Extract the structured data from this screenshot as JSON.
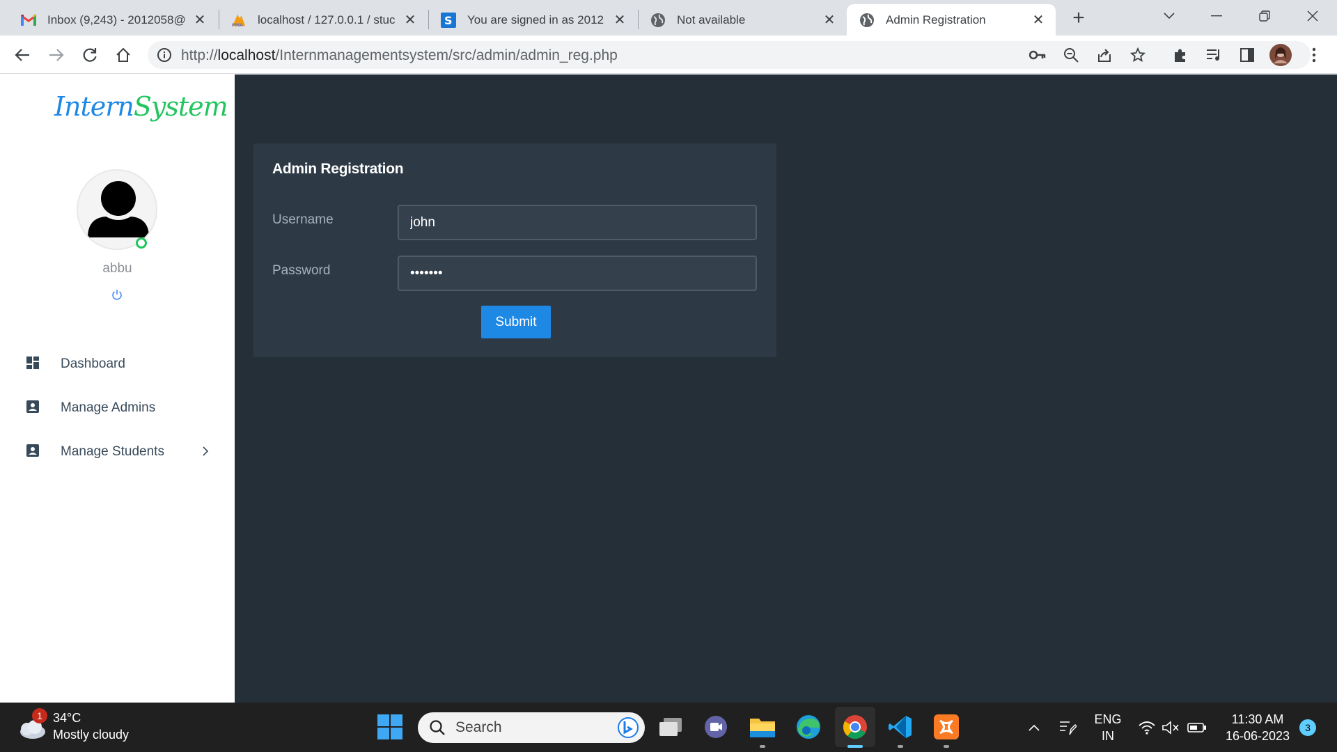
{
  "browser": {
    "tabs": [
      {
        "title": "Inbox (9,243) - 2012058@",
        "favicon": "gmail-icon"
      },
      {
        "title": "localhost / 127.0.0.1 / stuc",
        "favicon": "phpmyadmin-icon"
      },
      {
        "title": "You are signed in as 2012",
        "favicon": "s-icon"
      },
      {
        "title": "Not available",
        "favicon": "globe-icon"
      },
      {
        "title": "Admin Registration",
        "favicon": "globe-icon",
        "active": true
      }
    ],
    "url_prefix": "http://",
    "url_host": "localhost",
    "url_path": "/Internmanagementsystem/src/admin/admin_reg.php"
  },
  "sidebar": {
    "brand_part1": "Intern",
    "brand_part2": "System",
    "username": "abbu",
    "nav": [
      {
        "label": "Dashboard",
        "icon": "dashboard-icon"
      },
      {
        "label": "Manage Admins",
        "icon": "contact-card-icon"
      },
      {
        "label": "Manage Students",
        "icon": "contact-card-icon",
        "has_submenu": true
      }
    ]
  },
  "form": {
    "title": "Admin Registration",
    "username_label": "Username",
    "username_value": "john",
    "password_label": "Password",
    "password_value": "•••••••",
    "submit_label": "Submit"
  },
  "taskbar": {
    "weather_temp": "34°C",
    "weather_desc": "Mostly cloudy",
    "weather_badge": "1",
    "search_placeholder": "Search",
    "lang_top": "ENG",
    "lang_bottom": "IN",
    "time": "11:30 AM",
    "date": "16-06-2023",
    "notifications": "3"
  },
  "colors": {
    "main_bg": "#252f38",
    "card_bg": "#2d3a46",
    "accent": "#1e88e5",
    "brand_green": "#22c55e"
  }
}
